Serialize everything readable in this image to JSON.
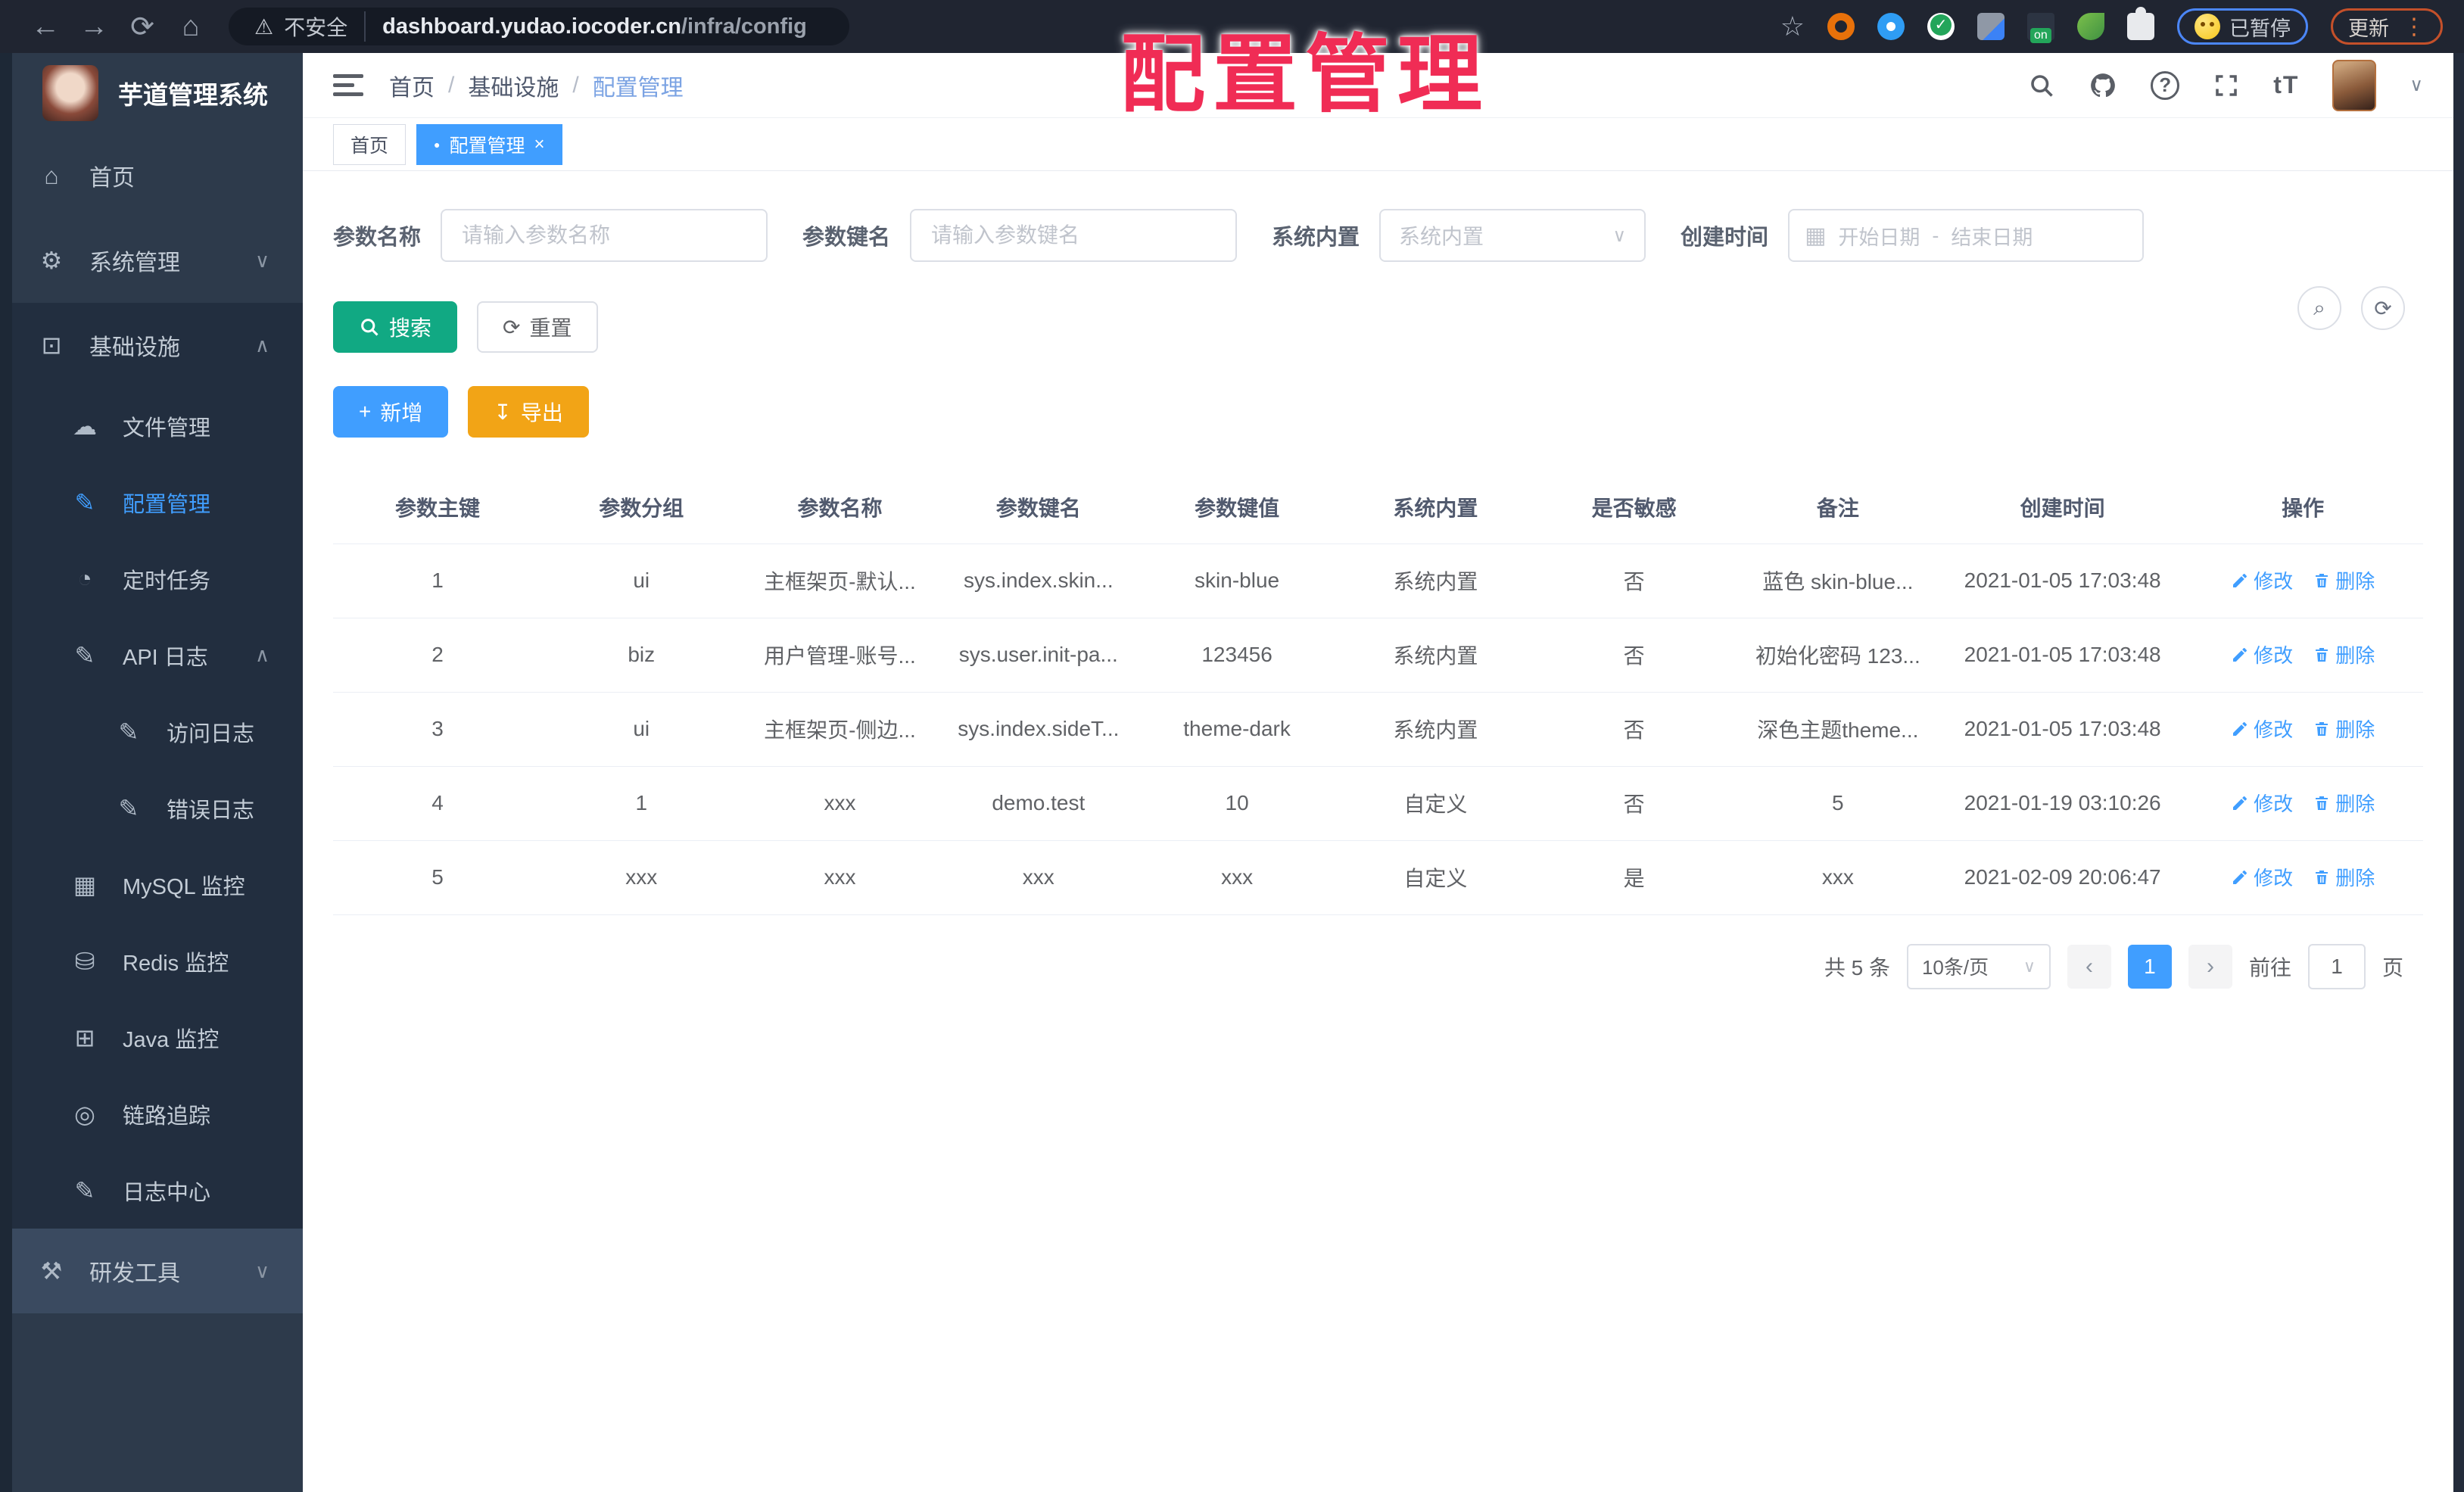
{
  "browser": {
    "warn_glyph": "⚠",
    "not_secure": "不安全",
    "url_host": "dashboard.yudao.iocoder.cn",
    "url_path": "/infra/config",
    "back": "←",
    "forward": "→",
    "reload": "⟳",
    "home": "⌂",
    "star": "☆",
    "ext_on_label": "on",
    "paused_label": "已暂停",
    "update_label": "更新",
    "kebab": "⋮"
  },
  "watermark": {
    "text": "配置管理"
  },
  "sidebar": {
    "title": "芋道管理系统",
    "items": [
      {
        "label": "首页",
        "glyph": "⌂"
      },
      {
        "label": "系统管理",
        "glyph": "⚙",
        "chevron": "∨"
      },
      {
        "label": "基础设施",
        "glyph": "⊡",
        "chevron": "∧"
      },
      {
        "label": "研发工具",
        "glyph": "⚒",
        "chevron": "∨"
      }
    ],
    "infra_children": [
      {
        "label": "文件管理",
        "glyph": "☁"
      },
      {
        "label": "配置管理",
        "glyph": "✎"
      },
      {
        "label": "定时任务",
        "glyph": "◔"
      },
      {
        "label": "API 日志",
        "glyph": "✎",
        "chevron": "∧"
      },
      {
        "label": "访问日志",
        "glyph": "✎"
      },
      {
        "label": "错误日志",
        "glyph": "✎"
      },
      {
        "label": "MySQL 监控",
        "glyph": "▦"
      },
      {
        "label": "Redis 监控",
        "glyph": "⛁"
      },
      {
        "label": "Java 监控",
        "glyph": "⊞"
      },
      {
        "label": "链路追踪",
        "glyph": "◎"
      },
      {
        "label": "日志中心",
        "glyph": "✎"
      }
    ]
  },
  "header": {
    "breadcrumb": [
      "首页",
      "基础设施",
      "配置管理"
    ],
    "separator": "/",
    "help_glyph": "?",
    "font_glyph": "tT",
    "caret": "∨"
  },
  "tabs": {
    "home": "首页",
    "active": "配置管理",
    "dot": "●",
    "close": "×"
  },
  "filters": {
    "name_label": "参数名称",
    "name_placeholder": "请输入参数名称",
    "key_label": "参数键名",
    "key_placeholder": "请输入参数键名",
    "type_label": "系统内置",
    "type_placeholder": "系统内置",
    "date_label": "创建时间",
    "date_start": "开始日期",
    "date_separator": "-",
    "date_end": "结束日期",
    "calendar_glyph": "▦",
    "caret": "∨"
  },
  "actions": {
    "search": "搜索",
    "reset": "重置",
    "add": "新增",
    "export": "导出",
    "search_glyph": "⌕",
    "reset_glyph": "⟳",
    "add_glyph": "+",
    "export_glyph": "↧",
    "zoom_glyph": "⌕",
    "refresh_glyph": "⟳"
  },
  "table": {
    "columns": [
      "参数主键",
      "参数分组",
      "参数名称",
      "参数键名",
      "参数键值",
      "系统内置",
      "是否敏感",
      "备注",
      "创建时间",
      "操作"
    ],
    "rows": [
      {
        "id": "1",
        "group": "ui",
        "name": "主框架页-默认...",
        "key": "sys.index.skin...",
        "value": "skin-blue",
        "builtin": "系统内置",
        "sensitive": "否",
        "remark": "蓝色 skin-blue...",
        "created": "2021-01-05 17:03:48"
      },
      {
        "id": "2",
        "group": "biz",
        "name": "用户管理-账号...",
        "key": "sys.user.init-pa...",
        "value": "123456",
        "builtin": "系统内置",
        "sensitive": "否",
        "remark": "初始化密码 123...",
        "created": "2021-01-05 17:03:48"
      },
      {
        "id": "3",
        "group": "ui",
        "name": "主框架页-侧边...",
        "key": "sys.index.sideT...",
        "value": "theme-dark",
        "builtin": "系统内置",
        "sensitive": "否",
        "remark": "深色主题theme...",
        "created": "2021-01-05 17:03:48"
      },
      {
        "id": "4",
        "group": "1",
        "name": "xxx",
        "key": "demo.test",
        "value": "10",
        "builtin": "自定义",
        "sensitive": "否",
        "remark": "5",
        "created": "2021-01-19 03:10:26"
      },
      {
        "id": "5",
        "group": "xxx",
        "name": "xxx",
        "key": "xxx",
        "value": "xxx",
        "builtin": "自定义",
        "sensitive": "是",
        "remark": "xxx",
        "created": "2021-02-09 20:06:47"
      }
    ],
    "op_edit": "修改",
    "op_delete": "删除"
  },
  "pagination": {
    "total": "共 5 条",
    "size": "10条/页",
    "caret": "∨",
    "prev": "‹",
    "page": "1",
    "next": "›",
    "goto": "前往",
    "goto_value": "1",
    "unit": "页"
  }
}
